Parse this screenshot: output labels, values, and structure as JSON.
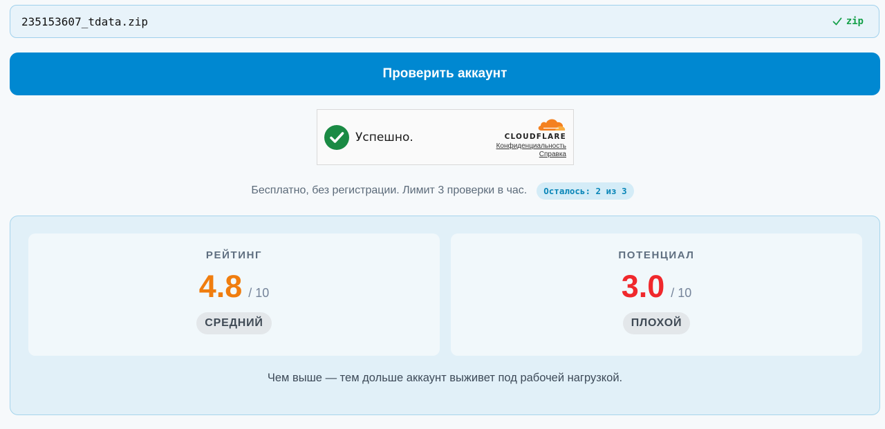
{
  "file": {
    "name": "235153607_tdata.zip",
    "status_label": "zip",
    "status_icon": "check-icon",
    "status_color": "#15a049"
  },
  "check_button": {
    "label": "Проверить аккаунт",
    "color": "#0088d1"
  },
  "captcha": {
    "status": "Успешно.",
    "status_icon": "check-circle-icon",
    "brand": "CLOUDFLARE",
    "privacy_link": "Конфиденциальность",
    "help_link": "Справка"
  },
  "limit": {
    "text": "Бесплатно, без регистрации. Лимит 3 проверки в час.",
    "remaining_badge": "Осталось: 2 из 3"
  },
  "results": {
    "rating": {
      "label": "РЕЙТИНГ",
      "value": "4.8",
      "max": "/ 10",
      "grade": "СРЕДНИЙ",
      "color": "#f07d0e"
    },
    "potential": {
      "label": "ПОТЕНЦИАЛ",
      "value": "3.0",
      "max": "/ 10",
      "grade": "ПЛОХОЙ",
      "color": "#f0282c"
    },
    "note": "Чем выше — тем дольше аккаунт выживет под рабочей нагрузкой."
  }
}
